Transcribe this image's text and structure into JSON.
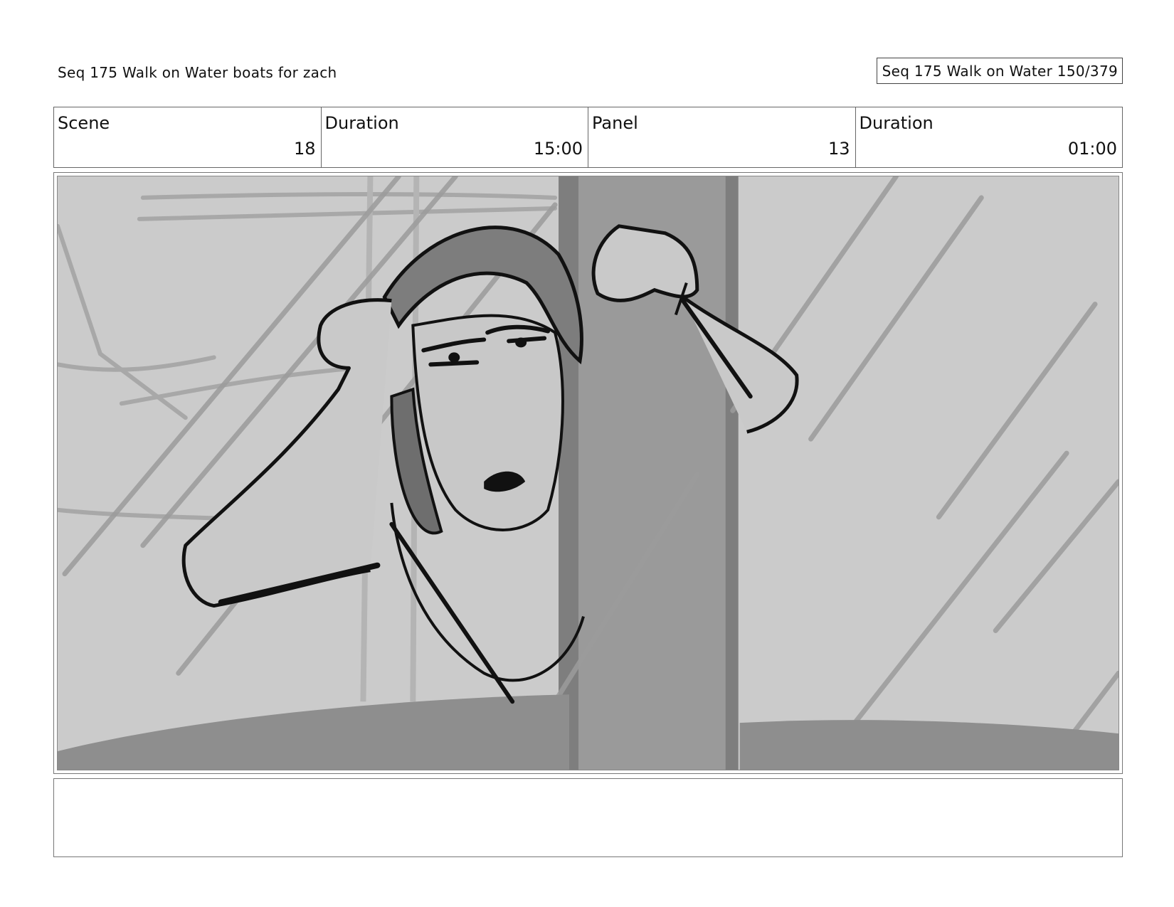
{
  "header": {
    "title": "Seq 175 Walk on Water  boats for zach",
    "page_label": "Seq 175 Walk on Water 150/379"
  },
  "info": [
    {
      "label": "Scene",
      "value": "18"
    },
    {
      "label": "Duration",
      "value": "15:00"
    },
    {
      "label": "Panel",
      "value": "13"
    },
    {
      "label": "Duration",
      "value": "01:00"
    }
  ],
  "notes": {
    "text": ""
  },
  "colors": {
    "panel_bg": "#cbcbcb",
    "mast": "#9a9a9a",
    "ink": "#111111"
  }
}
